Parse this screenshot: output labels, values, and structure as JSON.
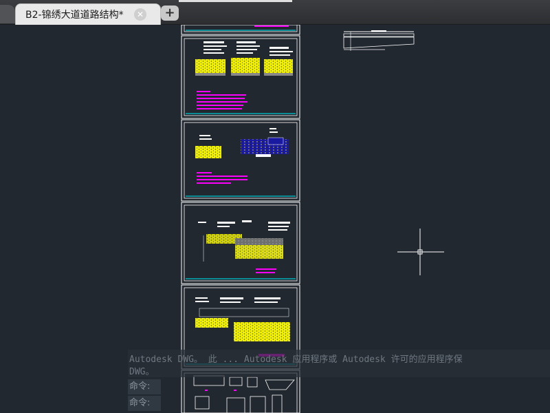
{
  "tabs": {
    "active_title": "B2-锦绣大道道路结构*",
    "close_glyph": "✕",
    "new_tab_glyph": "+"
  },
  "command": {
    "message_line1": "Autodesk DWG。 此 ... Autodesk 应用程序或 Autodesk 许可的应用程序保",
    "message_line2": "DWG。",
    "prompt1": "命令:",
    "prompt2": "命令:"
  },
  "colors": {
    "background": "#212830",
    "sheet_border": "#ffffff",
    "yellow_hatch": "#f2f200",
    "magenta_text": "#ff00ff",
    "cyan_titleblock": "#00c8d0",
    "blue_fill": "#1a1aa0"
  },
  "icons": {
    "crosshair": "crosshair-cursor-icon",
    "close": "close-icon",
    "add": "plus-icon"
  }
}
